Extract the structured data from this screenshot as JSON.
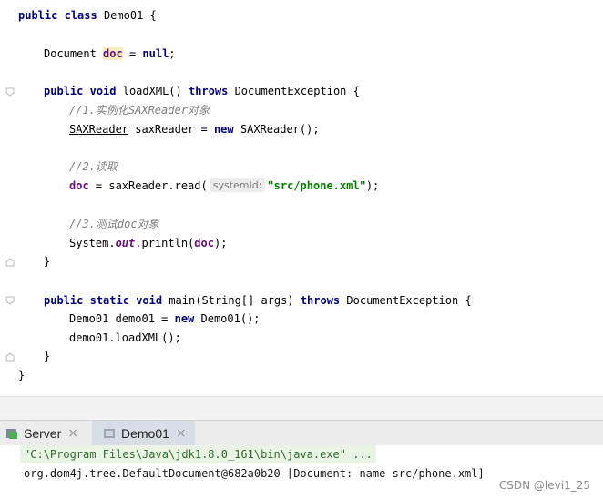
{
  "editor": {
    "lines": {
      "l1": {
        "kw_public": "public",
        "kw_class": "class",
        "rest": " Demo01 {"
      },
      "l2": {
        "type": "Document ",
        "var": "doc",
        "eq": " = ",
        "null_kw": "null",
        "semi": ";"
      },
      "l3": {
        "kw_public": "public",
        "kw_void": "void",
        "name": " loadXML() ",
        "kw_throws": "throws",
        "rest": " DocumentException {"
      },
      "l4": {
        "comment_a": "//1.实例化",
        "comment_b": "SAXReader",
        "comment_c": "对象"
      },
      "l5": {
        "type": "SAXReader",
        "mid": " saxReader = ",
        "kw_new": "new",
        "rest": " SAXReader();"
      },
      "l6": {
        "comment": "//2.读取"
      },
      "l7": {
        "var": "doc",
        "mid": " = saxReader.read(",
        "hint": "systemId:",
        "str": "\"src/phone.xml\"",
        "rest": ");"
      },
      "l8": {
        "comment_a": "//3.测试",
        "comment_b": "doc",
        "comment_c": "对象"
      },
      "l9": {
        "pre": "System.",
        "out": "out",
        "mid": ".println(",
        "var": "doc",
        "rest": ");"
      },
      "l10": {
        "text": "}"
      },
      "l11": {
        "kw_public": "public",
        "kw_static": "static",
        "kw_void": "void",
        "name": " main(String[] args) ",
        "kw_throws": "throws",
        "rest": " DocumentException {"
      },
      "l12": {
        "pre": "Demo01 demo01 = ",
        "kw_new": "new",
        "rest": " Demo01();"
      },
      "l13": {
        "text": "demo01.loadXML();"
      },
      "l14": {
        "text": "}"
      },
      "l15": {
        "text": "}"
      }
    }
  },
  "run_panel": {
    "tabs": [
      {
        "label": "Server",
        "icon": "server-icon",
        "active": false
      },
      {
        "label": "Demo01",
        "icon": "console-icon",
        "active": true
      }
    ],
    "console": {
      "line1": "\"C:\\Program Files\\Java\\jdk1.8.0_161\\bin\\java.exe\" ...",
      "line2": "org.dom4j.tree.DefaultDocument@682a0b20 [Document: name src/phone.xml]"
    }
  },
  "watermark": "CSDN @levi1_25",
  "colors": {
    "keyword": "#000080",
    "comment": "#808080",
    "string": "#008000",
    "field": "#660e7a",
    "highlight": "#f6ebbc"
  }
}
